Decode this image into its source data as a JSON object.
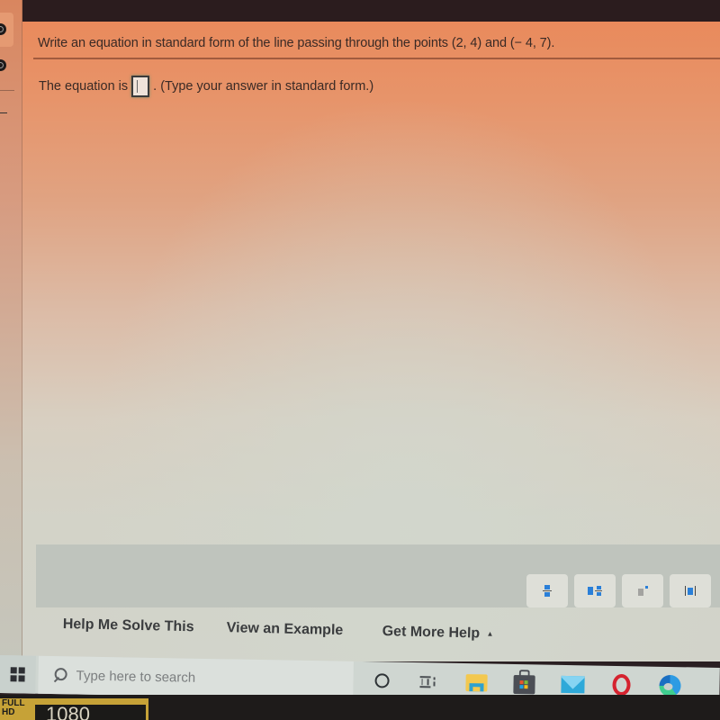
{
  "question": {
    "prompt": "Write an equation in standard form of the line passing through the points (2, 4) and (− 4, 7).",
    "answer_prefix": "The equation is",
    "answer_value": "",
    "answer_hint": ". (Type your answer in standard form.)"
  },
  "math_toolbar": {
    "buttons": [
      {
        "name": "fraction"
      },
      {
        "name": "mixed-number"
      },
      {
        "name": "exponent"
      },
      {
        "name": "absolute-value"
      }
    ]
  },
  "help": {
    "help_me_solve": "Help Me Solve This",
    "view_example": "View an Example",
    "get_more_help": "Get More Help",
    "get_more_help_caret": "▲"
  },
  "taskbar": {
    "search_placeholder": "Type here to search",
    "apps": [
      "cortana",
      "task-view",
      "file-explorer",
      "microsoft-store",
      "mail",
      "opera",
      "edge"
    ]
  },
  "sticker": {
    "label": "FULL HD",
    "text": "1080"
  },
  "colors": {
    "accent_blue": "#2a7fd8",
    "opera_red": "#d5232f",
    "question_bg_top": "#e98a5c"
  }
}
